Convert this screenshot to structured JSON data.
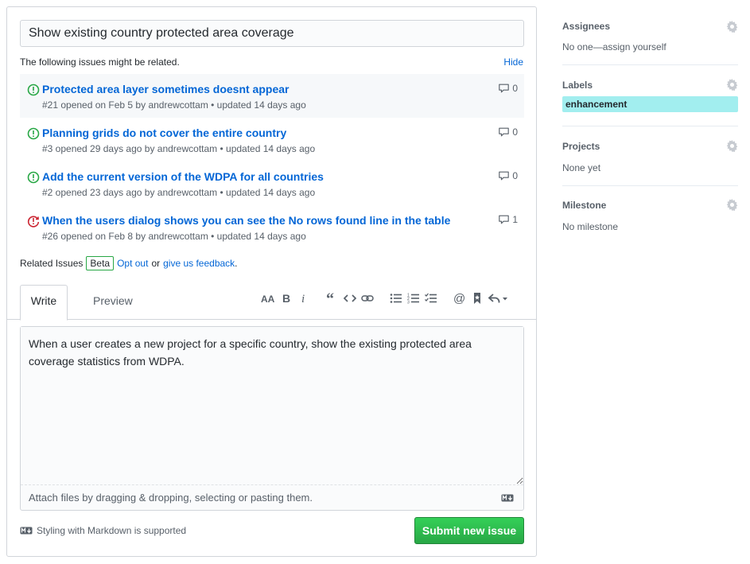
{
  "form": {
    "title_value": "Show existing country protected area coverage",
    "related_hint": "The following issues might be related.",
    "hide_label": "Hide",
    "issues": [
      {
        "title": "Protected area layer sometimes doesnt appear",
        "meta": "#21 opened on Feb 5 by andrewcottam • updated 14 days ago",
        "comments": "0",
        "state": "open"
      },
      {
        "title": "Planning grids do not cover the entire country",
        "meta": "#3 opened 29 days ago by andrewcottam • updated 14 days ago",
        "comments": "0",
        "state": "open"
      },
      {
        "title": "Add the current version of the WDPA for all countries",
        "meta": "#2 opened 23 days ago by andrewcottam • updated 14 days ago",
        "comments": "0",
        "state": "open"
      },
      {
        "title": "When the users dialog shows you can see the No rows found line in the table",
        "meta": "#26 opened on Feb 8 by andrewcottam • updated 14 days ago",
        "comments": "1",
        "state": "reopened"
      }
    ],
    "related_issues_label": "Related Issues",
    "beta_label": "Beta",
    "opt_out_label": "Opt out",
    "or_text": "or",
    "feedback_label": "give us feedback",
    "period": ".",
    "tabs": {
      "write": "Write",
      "preview": "Preview"
    },
    "body_text": "When a user creates a new project for a specific country, show the existing protected area coverage statistics from WDPA.",
    "attach_text": "Attach files by dragging & dropping, selecting or pasting them.",
    "markdown_note": "Styling with Markdown is supported",
    "submit_label": "Submit new issue"
  },
  "sidebar": {
    "assignees": {
      "heading": "Assignees",
      "value": "No one—assign yourself"
    },
    "labels": {
      "heading": "Labels",
      "chips": [
        {
          "name": "enhancement",
          "color": "#a2eeef"
        }
      ]
    },
    "projects": {
      "heading": "Projects",
      "value": "None yet"
    },
    "milestone": {
      "heading": "Milestone",
      "value": "No milestone"
    }
  },
  "colors": {
    "link": "#0366d6",
    "open": "#28a745",
    "reopened": "#cb2431",
    "submit": "#28a745"
  }
}
